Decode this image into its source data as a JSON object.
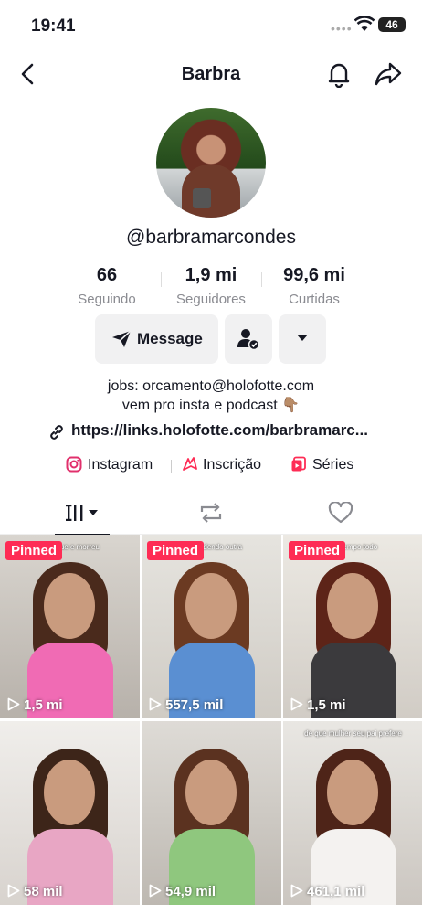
{
  "status": {
    "time": "19:41",
    "battery": "46"
  },
  "nav": {
    "title": "Barbra"
  },
  "profile": {
    "username": "@barbramarcondes",
    "stats": [
      {
        "value": "66",
        "label": "Seguindo"
      },
      {
        "value": "1,9 mi",
        "label": "Seguidores"
      },
      {
        "value": "99,6 mi",
        "label": "Curtidas"
      }
    ],
    "message_label": "Message",
    "bio_line1": "jobs: orcamento@holofotte.com",
    "bio_line2": "vem pro insta e podcast 👇🏽",
    "link": "https://links.holofotte.com/barbramarc...",
    "socials": [
      {
        "label": "Instagram"
      },
      {
        "label": "Inscrição"
      },
      {
        "label": "Séries"
      }
    ]
  },
  "videos": [
    {
      "pinned": "Pinned",
      "views": "1,5 mi",
      "caption": "se... que e morreu"
    },
    {
      "pinned": "Pinned",
      "views": "557,5 mil",
      "caption": "respondendo outra"
    },
    {
      "pinned": "Pinned",
      "views": "1,5 mi",
      "caption": "...o tempo todo"
    },
    {
      "pinned": "",
      "views": "58 mil",
      "caption": ""
    },
    {
      "pinned": "",
      "views": "54,9 mil",
      "caption": ""
    },
    {
      "pinned": "",
      "views": "461,1 mil",
      "caption": "de que mulher seu pai prefere"
    }
  ],
  "colors": {
    "accent": "#fe2c55",
    "button_bg": "#f1f1f2",
    "text": "#161823",
    "muted": "#8a8b91"
  }
}
